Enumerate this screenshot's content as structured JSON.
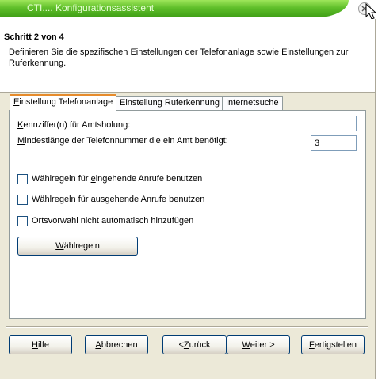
{
  "window": {
    "title": "CTI.... Konfigurationsassistent"
  },
  "header": {
    "step_title": "Schritt 2 von 4",
    "description": "Definieren Sie die spezifischen Einstellungen der Telefonanlage sowie Einstellungen zur Ruferkennung."
  },
  "tabs": [
    {
      "label_pre": "",
      "label_u": "E",
      "label_post": "instellung Telefonanlage",
      "active": true
    },
    {
      "label_pre": "Einstellung Ruferkennung",
      "label_u": "",
      "label_post": "",
      "active": false
    },
    {
      "label_pre": "Internetsuche",
      "label_u": "",
      "label_post": "",
      "active": false
    }
  ],
  "form": {
    "amt_label_u": "K",
    "amt_label_rest": "ennziffer(n) für Amtsholung:",
    "amt_value": "",
    "minlen_label_u": "M",
    "minlen_label_rest": "indestlänge der Telefonnummer die ein Amt benötigt:",
    "minlen_value": "3",
    "cb_incoming_pre": "Wählregeln für ",
    "cb_incoming_u": "e",
    "cb_incoming_post": "ingehende Anrufe benutzen",
    "cb_incoming_checked": false,
    "cb_outgoing_pre": "Wählregeln für a",
    "cb_outgoing_u": "u",
    "cb_outgoing_post": "sgehende Anrufe benutzen",
    "cb_outgoing_checked": false,
    "cb_area_pre": "Ortsvorwahl nicht automatisch hinzufügen",
    "cb_area_checked": false,
    "dialrules_u": "W",
    "dialrules_rest": "ählregeln"
  },
  "footer": {
    "help_u": "H",
    "help_rest": "ilfe",
    "cancel_u": "A",
    "cancel_rest": "bbrechen",
    "back_pre": "< ",
    "back_u": "Z",
    "back_rest": "urück",
    "next_u": "W",
    "next_rest": "eiter >",
    "finish_u": "F",
    "finish_rest": "ertigstellen"
  },
  "icons": {
    "close": "close-icon",
    "cursor": "mouse-pointer-icon"
  },
  "colors": {
    "title_green": "#5fbf2a",
    "active_tab_accent": "#e68b2c",
    "button_border": "#003c74"
  }
}
